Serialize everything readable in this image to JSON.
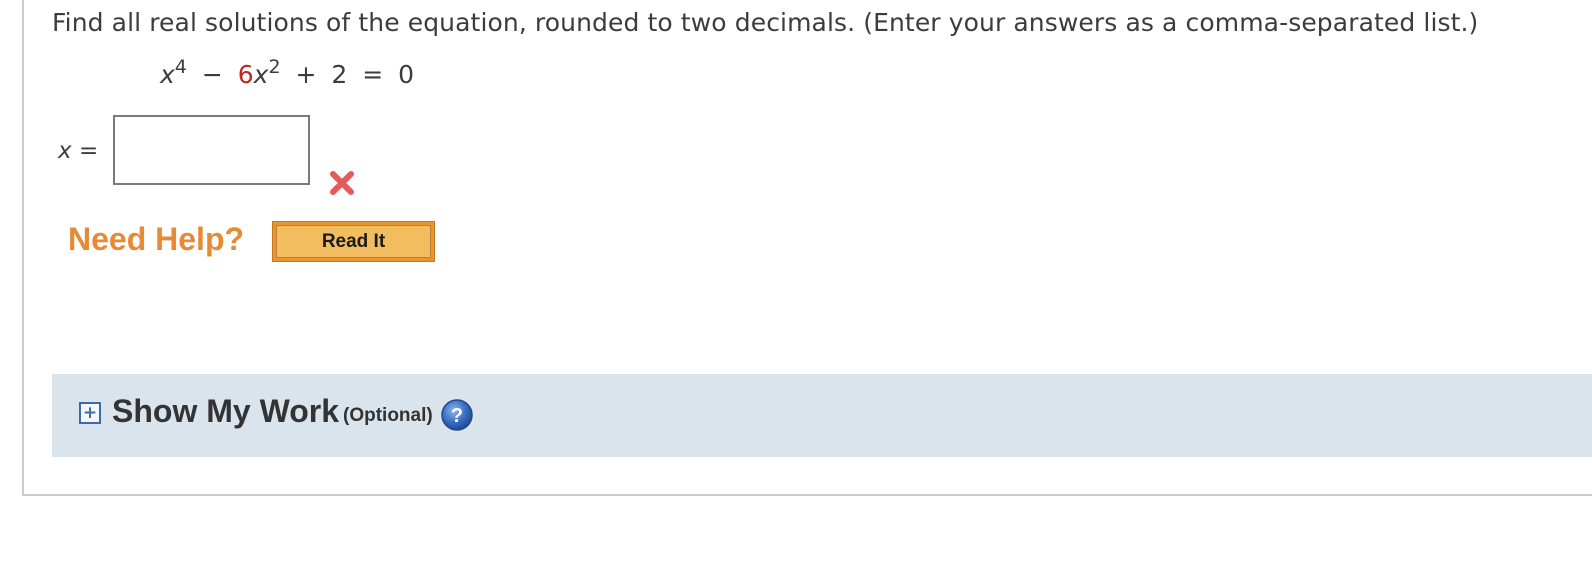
{
  "question": {
    "prompt": "Find all real solutions of the equation, rounded to two decimals. (Enter your answers as a comma-separated list.)",
    "equation": {
      "term1_var": "x",
      "term1_exp": "4",
      "op1": "−",
      "term2_coef": "6",
      "term2_var": "x",
      "term2_exp": "2",
      "op2": "+",
      "constant": "2",
      "equals": "=",
      "rhs": "0"
    },
    "coef_color": "#c0281f"
  },
  "answer": {
    "label_var": "x",
    "label_equals": "=",
    "value": "",
    "placeholder": "",
    "status": "incorrect",
    "status_icon": "x-mark-icon",
    "status_color": "#e55a5a"
  },
  "help": {
    "label": "Need Help?",
    "read_it_label": "Read It",
    "label_color": "#e68a35"
  },
  "show_my_work": {
    "toggle_icon": "plus-box-icon",
    "title": "Show My Work",
    "optional_label": "(Optional)",
    "help_icon": "question-circle-icon",
    "help_icon_text": "?"
  }
}
